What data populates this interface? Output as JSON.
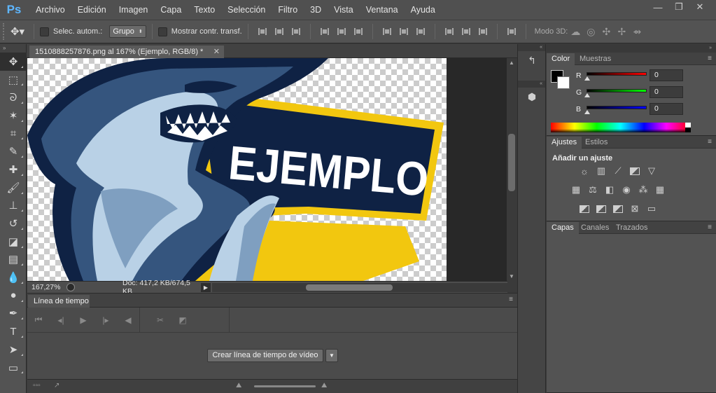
{
  "app": {
    "logo": "Ps"
  },
  "menu": [
    "Archivo",
    "Edición",
    "Imagen",
    "Capa",
    "Texto",
    "Selección",
    "Filtro",
    "3D",
    "Vista",
    "Ventana",
    "Ayuda"
  ],
  "window_controls": {
    "minimize": "—",
    "restore": "❐",
    "close": "✕"
  },
  "options_bar": {
    "auto_select_label": "Selec. autom.:",
    "group_select_value": "Grupo",
    "show_transform_label": "Mostrar contr. transf.",
    "mode3d_label": "Modo 3D:"
  },
  "document": {
    "tab_title": "1510888257876.png al 167% (Ejemplo, RGB/8) *",
    "close": "✕",
    "canvas_text": "EJEMPLO",
    "zoom": "167,27%",
    "doc_size": "Doc: 417,2 KB/674,5 KB"
  },
  "timeline": {
    "tab_label": "Línea de tiempo",
    "create_button": "Crear línea de tiempo de vídeo"
  },
  "color_panel": {
    "tabs": [
      "Color",
      "Muestras"
    ],
    "sliders": [
      {
        "label": "R",
        "value": "0"
      },
      {
        "label": "G",
        "value": "0"
      },
      {
        "label": "B",
        "value": "0"
      }
    ]
  },
  "adjust_panel": {
    "tabs": [
      "Ajustes",
      "Estilos"
    ],
    "title": "Añadir un ajuste"
  },
  "layers_panel": {
    "tabs": [
      "Capas",
      "Canales",
      "Trazados"
    ]
  },
  "colors": {
    "navy": "#0f2244",
    "yellow": "#f2c70f",
    "shark_light": "#b9d1e6",
    "shark_mid": "#7f9fc0",
    "shark_dark": "#35557e"
  }
}
